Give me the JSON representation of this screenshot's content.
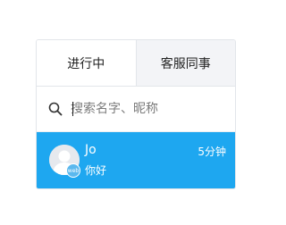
{
  "tabs": [
    {
      "label": "进行中",
      "active": true
    },
    {
      "label": "客服同事",
      "active": false
    }
  ],
  "search": {
    "placeholder": "搜索名字、昵称",
    "icon": "search-icon"
  },
  "conversations": [
    {
      "name": "Jo",
      "time": "5分钟",
      "message": "你好",
      "badge": "web",
      "avatar_icon": "default-user-icon"
    }
  ],
  "colors": {
    "selected_bg": "#1ea7f0",
    "inactive_tab_bg": "#f3f4f7",
    "border": "#e2e5ea"
  }
}
